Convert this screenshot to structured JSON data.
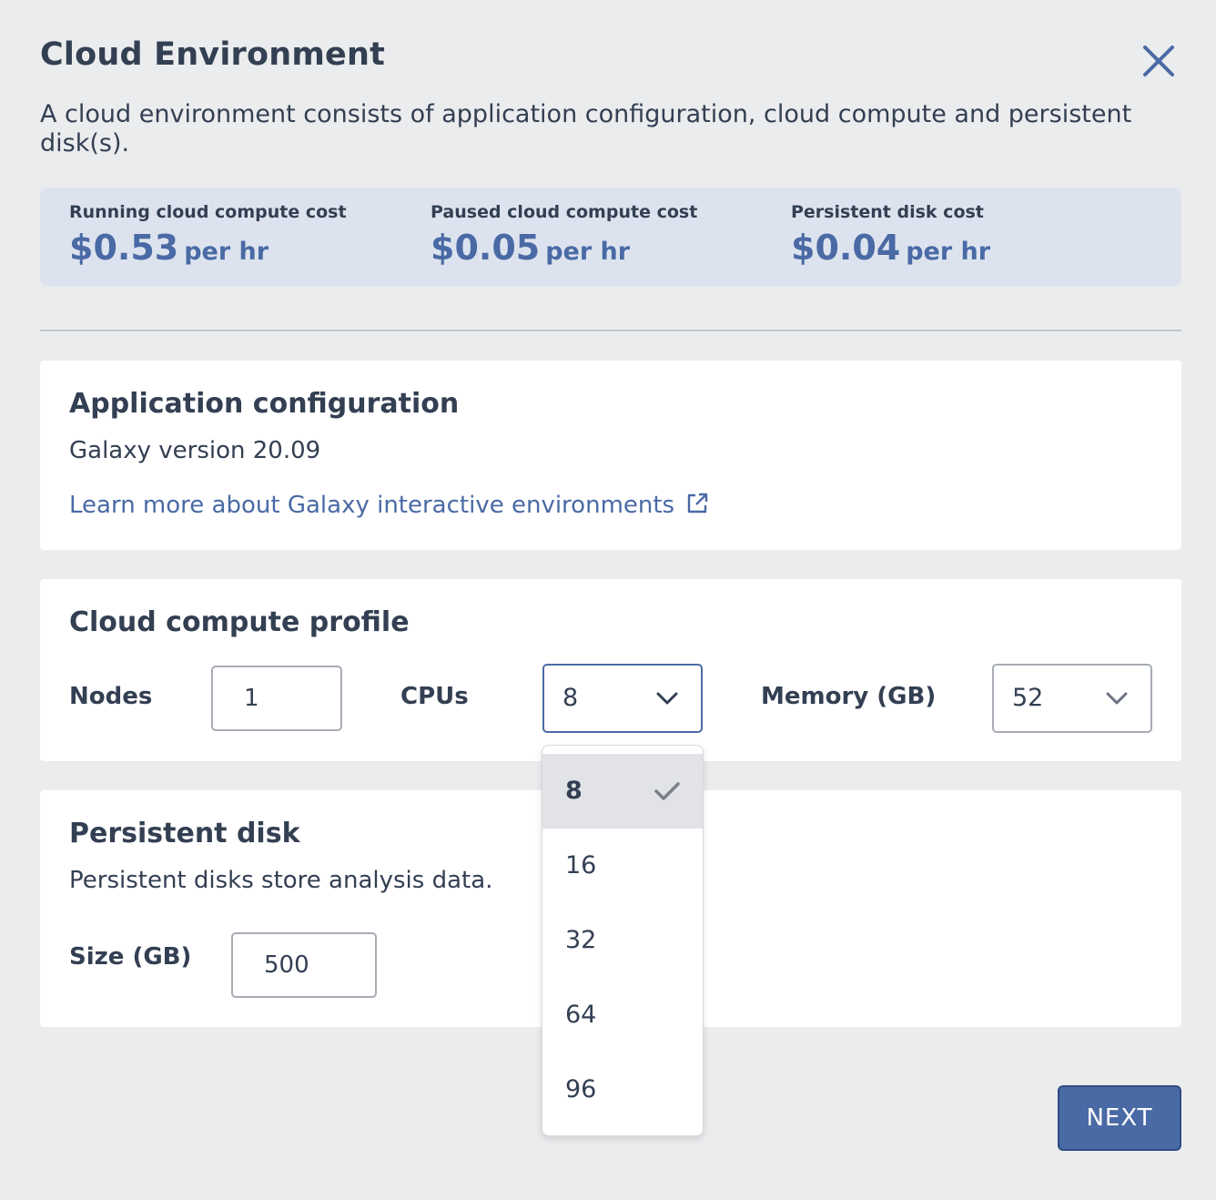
{
  "dialog": {
    "title": "Cloud Environment",
    "description": "A cloud environment consists of application configuration, cloud compute and persistent disk(s)."
  },
  "costs": [
    {
      "label": "Running cloud compute cost",
      "amount": "$0.53",
      "unit": "per hr"
    },
    {
      "label": "Paused cloud compute cost",
      "amount": "$0.05",
      "unit": "per hr"
    },
    {
      "label": "Persistent disk cost",
      "amount": "$0.04",
      "unit": "per hr"
    }
  ],
  "app_config": {
    "title": "Application configuration",
    "version": "Galaxy version 20.09",
    "link": "Learn more about Galaxy interactive environments"
  },
  "compute": {
    "title": "Cloud compute profile",
    "nodes_label": "Nodes",
    "nodes_value": "1",
    "cpus_label": "CPUs",
    "cpus_value": "8",
    "memory_label": "Memory (GB)",
    "memory_value": "52",
    "cpu_options": [
      "8",
      "16",
      "32",
      "64",
      "96"
    ]
  },
  "disk": {
    "title": "Persistent disk",
    "description": "Persistent disks store analysis data.",
    "size_label": "Size (GB)",
    "size_value": "500"
  },
  "footer": {
    "next_label": "NEXT"
  },
  "colors": {
    "accent": "#4a6aa5",
    "text": "#333f52",
    "background": "#ebecee",
    "cost_bar": "#dde3ee"
  }
}
